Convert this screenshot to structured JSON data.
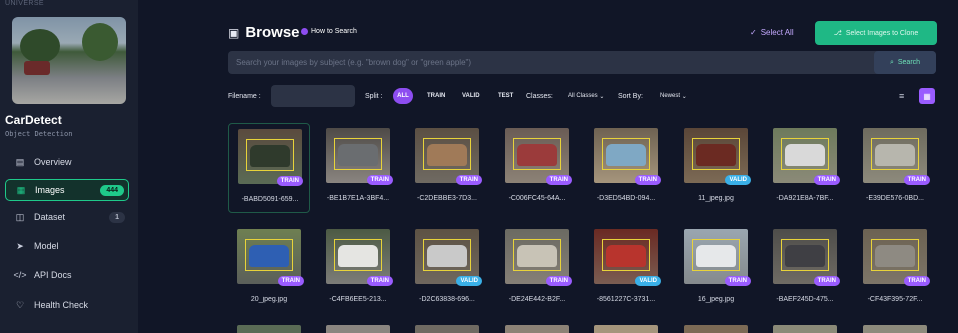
{
  "sidebar": {
    "top_label": "UNIVERSE",
    "project": {
      "name": "CarDetect",
      "type": "Object Detection"
    },
    "items": [
      {
        "label": "Overview",
        "icon": "overview-icon",
        "glyph": "▤"
      },
      {
        "label": "Images",
        "icon": "images-icon",
        "glyph": "▦",
        "count": "444",
        "active": true
      },
      {
        "label": "Dataset",
        "icon": "dataset-icon",
        "glyph": "◫",
        "count": "1"
      },
      {
        "label": "Model",
        "icon": "model-icon",
        "glyph": "➤"
      },
      {
        "label": "API Docs",
        "icon": "code-icon",
        "glyph": "</>"
      },
      {
        "label": "Health Check",
        "icon": "health-check-icon",
        "glyph": "♡"
      }
    ]
  },
  "header": {
    "title": "Browse",
    "how_to": "How to Search",
    "select_all": "Select All",
    "clone_button": "Select Images to Clone"
  },
  "search": {
    "placeholder": "Search your images by subject (e.g. \"brown dog\" or \"green apple\")",
    "button": "Search"
  },
  "filters": {
    "filename_label": "Filename :",
    "split_label": "Split :",
    "splits": [
      "ALL",
      "TRAIN",
      "VALID",
      "TEST"
    ],
    "classes_label": "Classes:",
    "classes_value": "All Classes",
    "sort_label": "Sort By:",
    "sort_value": "Newest"
  },
  "images": [
    {
      "name": "-BABD5091-659...",
      "split": "TRAIN",
      "colors": [
        "#5a4a3e",
        "#2f3a2c",
        "#5a6b55"
      ]
    },
    {
      "name": "-BE1B7E1A-3BF4...",
      "split": "TRAIN",
      "colors": [
        "#4e4a47",
        "#6a6d70",
        "#8a8580"
      ]
    },
    {
      "name": "-C2DEBBE3-7D3...",
      "split": "TRAIN",
      "colors": [
        "#5b4f43",
        "#a07a58",
        "#6f6a62"
      ]
    },
    {
      "name": "-C006FC45-64A...",
      "split": "TRAIN",
      "colors": [
        "#6a5c55",
        "#9b3b3b",
        "#8c8276"
      ]
    },
    {
      "name": "-D3ED54BD-094...",
      "split": "TRAIN",
      "colors": [
        "#6e6252",
        "#7fa8c4",
        "#a5957c"
      ]
    },
    {
      "name": "11_jpeg.jpg",
      "split": "VALID",
      "colors": [
        "#5a4638",
        "#6b2a22",
        "#7c6a55"
      ]
    },
    {
      "name": "-DA921E8A-7BF...",
      "split": "TRAIN",
      "colors": [
        "#6d7a5c",
        "#d9d9d9",
        "#8b8a78"
      ]
    },
    {
      "name": "-E39DE576-0BD...",
      "split": "TRAIN",
      "colors": [
        "#6e6b5e",
        "#b7b6ad",
        "#8d8a7c"
      ]
    },
    {
      "name": "20_jpeg.jpg",
      "split": "TRAIN",
      "colors": [
        "#6e7f52",
        "#2e5fb3",
        "#5b5f5a"
      ]
    },
    {
      "name": "-C4FB6EE5-213...",
      "split": "TRAIN",
      "colors": [
        "#4c5a44",
        "#e5e5e2",
        "#7c7c78"
      ]
    },
    {
      "name": "-D2C63838-696...",
      "split": "VALID",
      "colors": [
        "#5d5244",
        "#c9c9c9",
        "#6f675e"
      ]
    },
    {
      "name": "-DE24E442-B2F...",
      "split": "TRAIN",
      "colors": [
        "#6b6a62",
        "#c8c3b6",
        "#857f76"
      ]
    },
    {
      "name": "-8561227C-3731...",
      "split": "VALID",
      "colors": [
        "#6a2a23",
        "#b8342d",
        "#7a5d52"
      ]
    },
    {
      "name": "16_jpeg.jpg",
      "split": "TRAIN",
      "colors": [
        "#9aa6b0",
        "#e6e8ea",
        "#858a8d"
      ]
    },
    {
      "name": "-BAEF245D-475...",
      "split": "TRAIN",
      "colors": [
        "#4e4d4a",
        "#3f3f44",
        "#6f6b64"
      ]
    },
    {
      "name": "-CF43F395-72F...",
      "split": "TRAIN",
      "colors": [
        "#6c6252",
        "#8e8a82",
        "#7d7568"
      ]
    }
  ]
}
